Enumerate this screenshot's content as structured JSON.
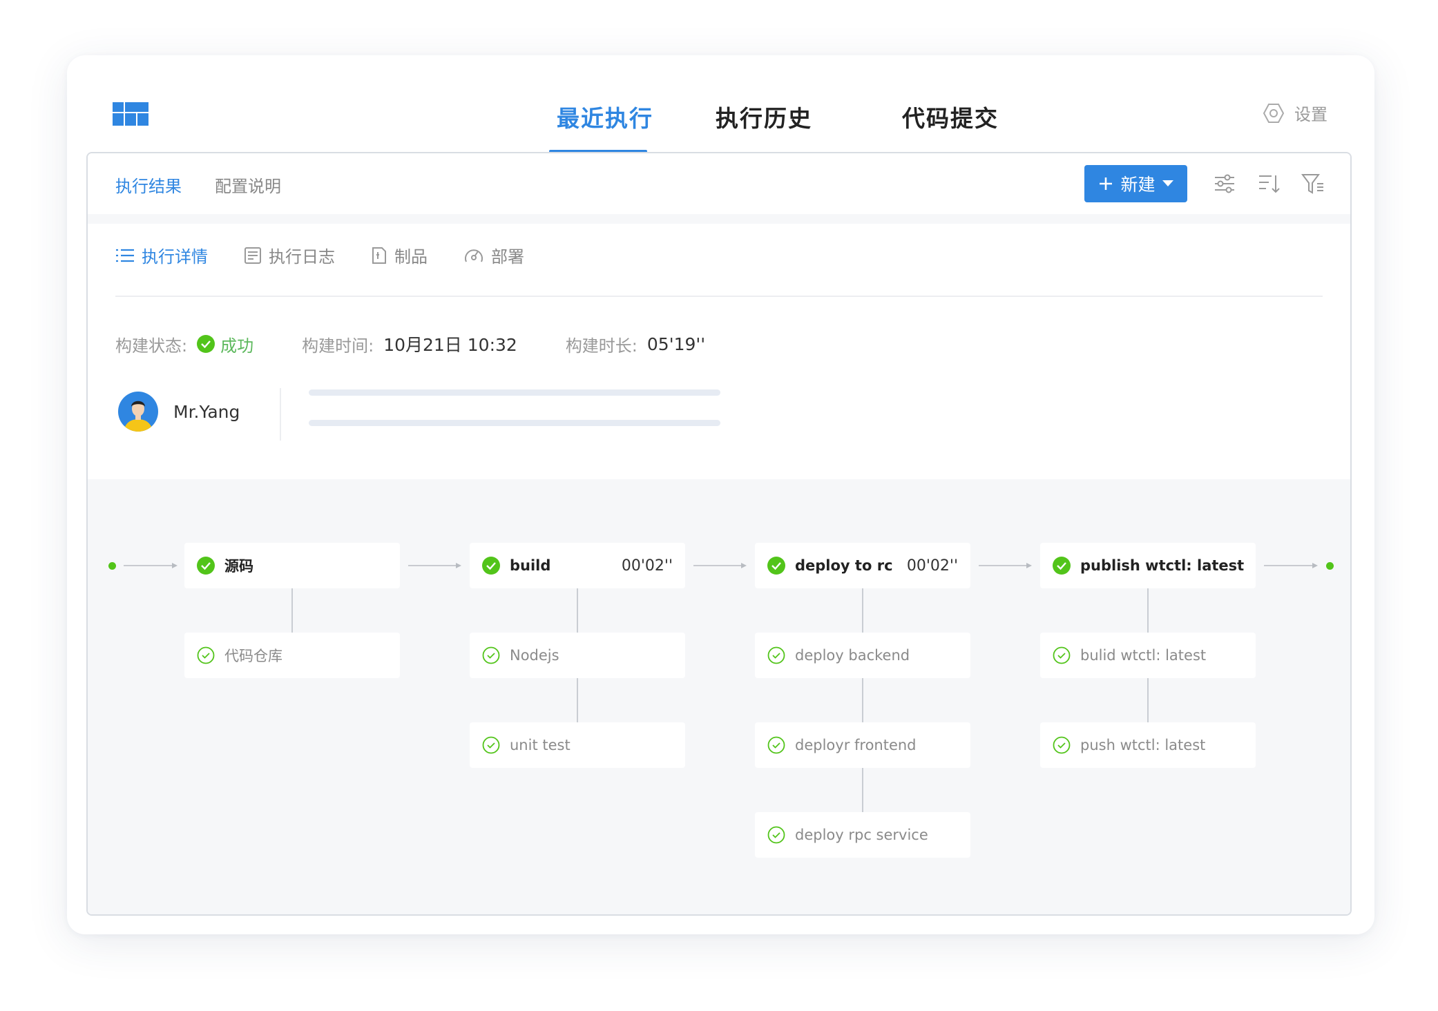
{
  "topnav": {
    "tabs": [
      "最近执行",
      "执行历史",
      "代码提交"
    ],
    "active": 0,
    "settings_label": "设置"
  },
  "subbar": {
    "tabs": [
      "执行结果",
      "配置说明"
    ],
    "active": 0,
    "new_button": "新建"
  },
  "detail_tabs": [
    "执行详情",
    "执行日志",
    "制品",
    "部署"
  ],
  "build_info": {
    "status_label": "构建状态:",
    "status_value": "成功",
    "time_label": "构建时间:",
    "time_value": "10月21日 10:32",
    "duration_label": "构建时长:",
    "duration_value": "05'19''"
  },
  "user": {
    "name": "Mr.Yang"
  },
  "colors": {
    "accent": "#2f86e1",
    "success": "#52c41a"
  },
  "pipeline": {
    "stages": [
      {
        "title": "源码",
        "duration": "",
        "steps": [
          "代码仓库"
        ]
      },
      {
        "title": "build",
        "duration": "00'02''",
        "steps": [
          "Nodejs",
          "unit test"
        ]
      },
      {
        "title": "deploy to rc",
        "duration": "00'02''",
        "steps": [
          "deploy backend",
          "deployr frontend",
          "deploy rpc service"
        ]
      },
      {
        "title": "publish wtctl: latest",
        "duration": "",
        "steps": [
          "bulid wtctl: latest",
          "push wtctl: latest"
        ]
      }
    ]
  }
}
